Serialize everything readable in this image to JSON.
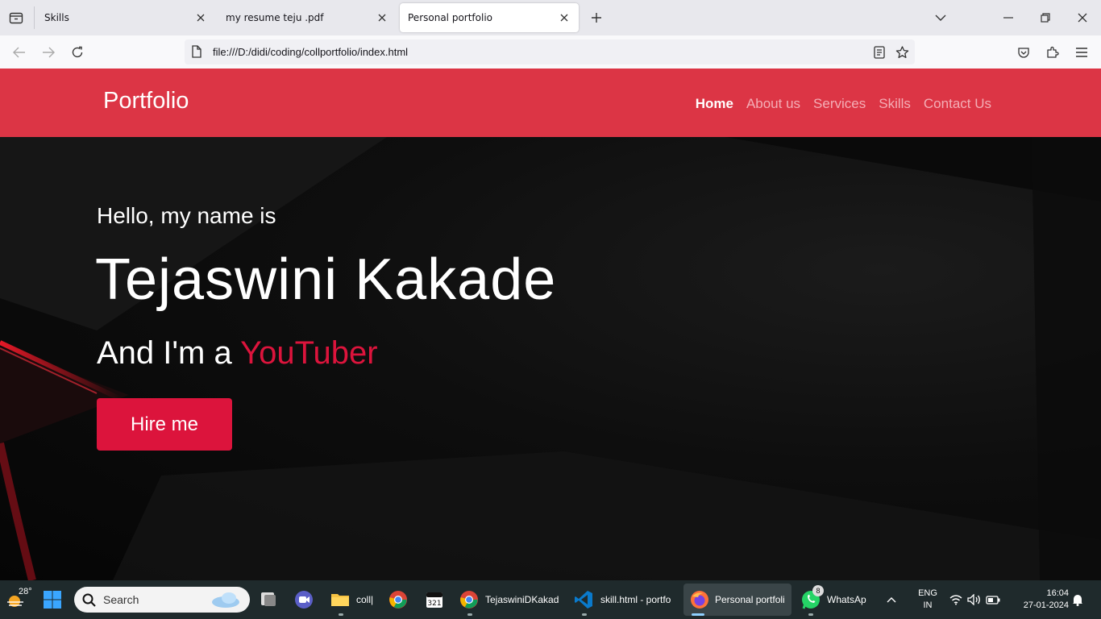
{
  "browser": {
    "tabs": [
      {
        "label": "Skills",
        "active": false
      },
      {
        "label": "my resume teju .pdf",
        "active": false
      },
      {
        "label": "Personal portfolio",
        "active": true
      }
    ],
    "url": "file:///D:/didi/coding/collportfolio/index.html"
  },
  "site": {
    "logo": "Portfolio",
    "nav": [
      "Home",
      "About us",
      "Services",
      "Skills",
      "Contact Us"
    ],
    "hero": {
      "greeting": "Hello, my name is",
      "name": "Tejaswini Kakade",
      "role_prefix": "And I'm a ",
      "role": "YouTuber",
      "cta": "Hire me"
    },
    "colors": {
      "header": "#dc3545",
      "accent": "#dc143c"
    }
  },
  "taskbar": {
    "weather": "28°",
    "search_placeholder": "Search",
    "apps": [
      {
        "label": "coll|",
        "icon": "folder-icon"
      },
      {
        "label": "TejaswiniDKakad",
        "icon": "chrome-icon"
      },
      {
        "label": "skill.html - portfo",
        "icon": "vscode-icon"
      },
      {
        "label": "Personal portfoli",
        "icon": "firefox-icon"
      },
      {
        "label": "WhatsAp",
        "icon": "whatsapp-icon"
      }
    ],
    "whatsapp_badge": "8",
    "language": "ENG",
    "region": "IN",
    "time": "16:04",
    "date": "27-01-2024"
  }
}
